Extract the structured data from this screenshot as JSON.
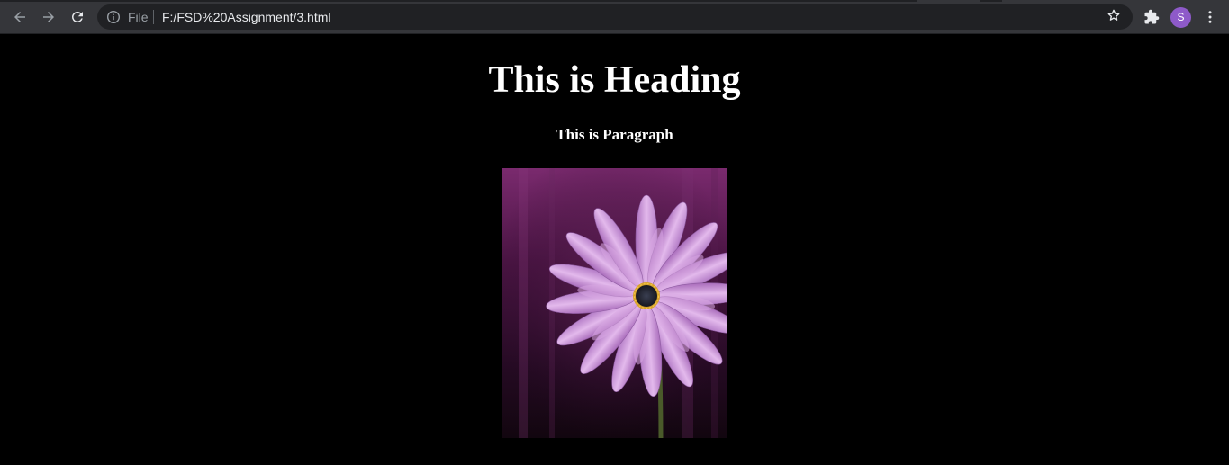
{
  "browser": {
    "omnibox": {
      "scheme_label": "File",
      "url": "F:/FSD%20Assignment/3.html"
    },
    "profile_initial": "S",
    "icons": [
      "back-arrow-icon",
      "forward-arrow-icon",
      "reload-icon",
      "info-icon",
      "star-icon",
      "puzzle-icon",
      "more-vert-icon"
    ],
    "colors": {
      "toolbar": "#35363a",
      "omnibox": "#202124",
      "avatar": "#8e5ac9"
    }
  },
  "page": {
    "heading": "This is Heading",
    "paragraph": "This is Paragraph",
    "image": {
      "subject": "purple daisy flower",
      "colors": {
        "background": "#3a0f35",
        "petals": "#c98fd6",
        "center": "#2a2e3a",
        "ring": "#d8a32b"
      }
    },
    "background_color": "#000000",
    "text_color": "#ffffff"
  }
}
